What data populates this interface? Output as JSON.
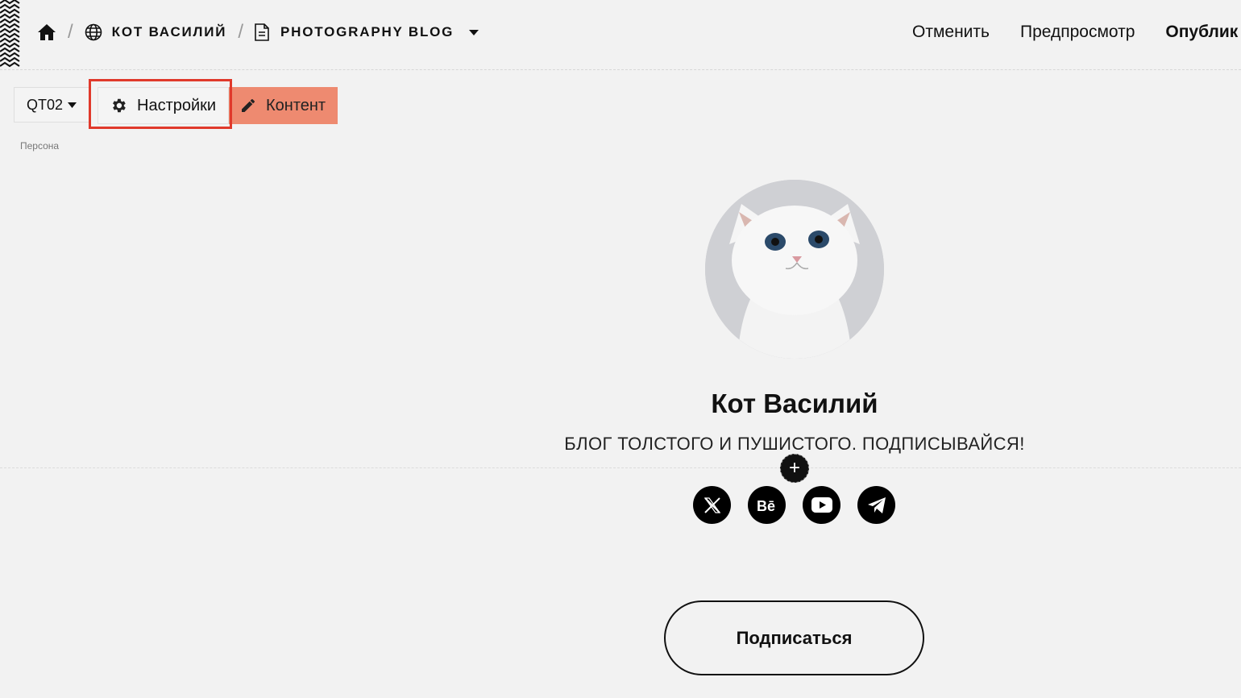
{
  "breadcrumb": {
    "home_icon": "home-icon",
    "site_icon": "globe-icon",
    "site_name": "КОТ ВАСИЛИЙ",
    "page_icon": "document-icon",
    "page_name": "PHOTOGRAPHY BLOG",
    "separator": "/"
  },
  "header_actions": {
    "cancel": "Отменить",
    "preview": "Предпросмотр",
    "publish": "Опублик"
  },
  "toolbar": {
    "block_code": "QT02",
    "settings_label": "Настройки",
    "content_label": "Контент"
  },
  "block_label": "Персона",
  "profile": {
    "name": "Кот Василий",
    "tagline": "БЛОГ ТОЛСТОГО И ПУШИСТОГО. ПОДПИСЫВАЙСЯ!",
    "add_symbol": "+",
    "subscribe_label": "Подписаться",
    "socials": [
      "x-icon",
      "behance-icon",
      "youtube-icon",
      "telegram-icon"
    ]
  },
  "colors": {
    "background": "#f2f2f2",
    "accent": "#ee8a70",
    "highlight": "#e0392b"
  }
}
